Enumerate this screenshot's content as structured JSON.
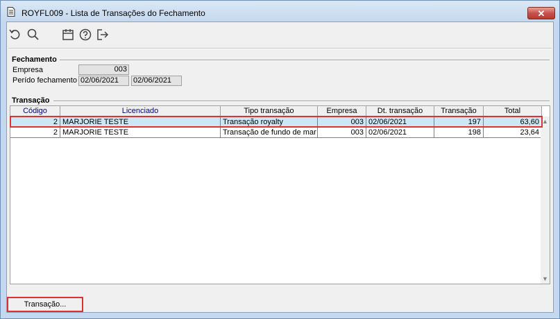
{
  "window": {
    "title": "ROYFL009 - Lista de Transações do Fechamento",
    "close_label": "✕"
  },
  "toolbar": {
    "icons": [
      "undo-icon",
      "search-icon",
      "calendar-icon",
      "help-icon",
      "exit-icon"
    ]
  },
  "fechamento": {
    "group_title": "Fechamento",
    "empresa_label": "Empresa",
    "empresa_value": "003",
    "periodo_label": "Perído fechamento",
    "periodo_inicio": "02/06/2021",
    "periodo_fim": "02/06/2021"
  },
  "transacao": {
    "group_title": "Transação",
    "columns": [
      "Código",
      "Licenciado",
      "Tipo transação",
      "Empresa",
      "Dt. transação",
      "Transação",
      "Total"
    ],
    "rows": [
      {
        "codigo": "2",
        "licenciado": "MARJORIE TESTE",
        "tipo": "Transação royalty",
        "empresa": "003",
        "dt": "02/06/2021",
        "transacao": "197",
        "total": "63,60"
      },
      {
        "codigo": "2",
        "licenciado": "MARJORIE TESTE",
        "tipo": "Transação de fundo de mar",
        "empresa": "003",
        "dt": "02/06/2021",
        "transacao": "198",
        "total": "23,64"
      }
    ],
    "button_label": "Transação..."
  },
  "colors": {
    "selection": "#cde8f5",
    "highlight": "#e03131",
    "header_blue": "#000080"
  }
}
